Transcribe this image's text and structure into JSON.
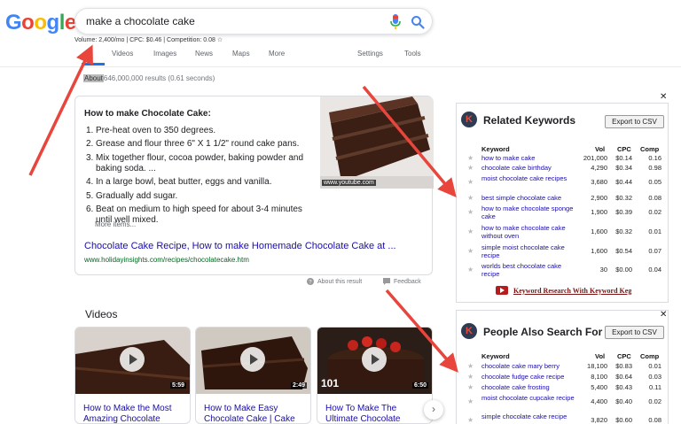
{
  "logo": {
    "letters": [
      "G",
      "o",
      "o",
      "g",
      "l",
      "e"
    ],
    "colors": [
      "#4285f4",
      "#ea4335",
      "#fbbc05",
      "#4285f4",
      "#34a853",
      "#ea4335"
    ]
  },
  "search": {
    "query": "make a chocolate cake"
  },
  "volume_line": "Volume: 2,400/mo | CPC: $0.46 | Competition: 0.08 ☆",
  "tabs": [
    "All",
    "Videos",
    "Images",
    "News",
    "Maps",
    "More",
    "Settings",
    "Tools"
  ],
  "stats": {
    "about": "About",
    "rest": "646,000,000 results (0.61 seconds)"
  },
  "snippet": {
    "title": "How to make Chocolate Cake:",
    "steps": [
      {
        "n": "1.",
        "text": "Pre-heat oven to 350 degrees."
      },
      {
        "n": "2.",
        "text": "Grease and flour three 6\" X 1 1/2\" round cake pans."
      },
      {
        "n": "3.",
        "text": "Mix together flour, cocoa powder, baking powder and baking soda. ..."
      },
      {
        "n": "4.",
        "text": "In a large bowl, beat butter, eggs and vanilla."
      },
      {
        "n": "5.",
        "text": "Gradually add sugar."
      },
      {
        "n": "6.",
        "text": "Beat on medium to high speed for about 3-4 minutes until well mixed."
      }
    ],
    "more_items": "More items...",
    "link": "Chocolate Cake Recipe, How to make Homemade Chocolate Cake at ...",
    "url": "www.holidayinsights.com/recipes/chocolatecake.htm",
    "image_caption": "www.youtube.com"
  },
  "about_result": "About this result",
  "feedback": "Feedback",
  "videos": {
    "heading": "Videos",
    "items": [
      {
        "title": "How to Make the Most Amazing Chocolate",
        "duration": "5:59"
      },
      {
        "title": "How to Make Easy Chocolate Cake | Cake",
        "duration": "2:49"
      },
      {
        "title": "How To Make The Ultimate Chocolate",
        "duration": "6:50",
        "badge": "101"
      }
    ]
  },
  "related": {
    "logo_letter": "K",
    "title": "Related Keywords",
    "export": "Export to CSV",
    "close": "✕",
    "headers": {
      "keyword": "Keyword",
      "vol": "Vol",
      "cpc": "CPC",
      "comp": "Comp"
    },
    "rows": [
      {
        "kw": "how to make cake",
        "vol": "201,000",
        "cpc": "$0.14",
        "comp": "0.16"
      },
      {
        "kw": "chocolate cake birthday",
        "vol": "4,290",
        "cpc": "$0.34",
        "comp": "0.98"
      },
      {
        "kw": "moist chocolate cake recipes",
        "vol": "3,680",
        "cpc": "$0.44",
        "comp": "0.05"
      },
      {
        "kw": "best simple chocolate cake",
        "vol": "2,900",
        "cpc": "$0.32",
        "comp": "0.08"
      },
      {
        "kw": "how to make chocolate sponge cake",
        "vol": "1,900",
        "cpc": "$0.39",
        "comp": "0.02"
      },
      {
        "kw": "how to make chocolate cake without oven",
        "vol": "1,600",
        "cpc": "$0.32",
        "comp": "0.01"
      },
      {
        "kw": "simple moist chocolate cake recipe",
        "vol": "1,600",
        "cpc": "$0.54",
        "comp": "0.07"
      },
      {
        "kw": "worlds best chocolate cake recipe",
        "vol": "30",
        "cpc": "$0.00",
        "comp": "0.04"
      }
    ],
    "footer": "Keyword Research With Keyword Keg"
  },
  "people_also": {
    "logo_letter": "K",
    "title": "People Also Search For",
    "export": "Export to CSV",
    "close": "✕",
    "headers": {
      "keyword": "Keyword",
      "vol": "Vol",
      "cpc": "CPC",
      "comp": "Comp"
    },
    "rows": [
      {
        "kw": "chocolate cake mary berry",
        "vol": "18,100",
        "cpc": "$0.83",
        "comp": "0.01"
      },
      {
        "kw": "chocolate fudge cake recipe",
        "vol": "8,100",
        "cpc": "$0.64",
        "comp": "0.03"
      },
      {
        "kw": "chocolate cake frosting",
        "vol": "5,400",
        "cpc": "$0.43",
        "comp": "0.11"
      },
      {
        "kw": "moist chocolate cupcake recipe",
        "vol": "4,400",
        "cpc": "$0.40",
        "comp": "0.02"
      },
      {
        "kw": "simple chocolate cake recipe",
        "vol": "3,820",
        "cpc": "$0.60",
        "comp": "0.08"
      }
    ]
  },
  "colors": {
    "link": "#1a0dab",
    "url": "#006621",
    "accent": "#1a73e8",
    "arrow": "#e8453c"
  }
}
